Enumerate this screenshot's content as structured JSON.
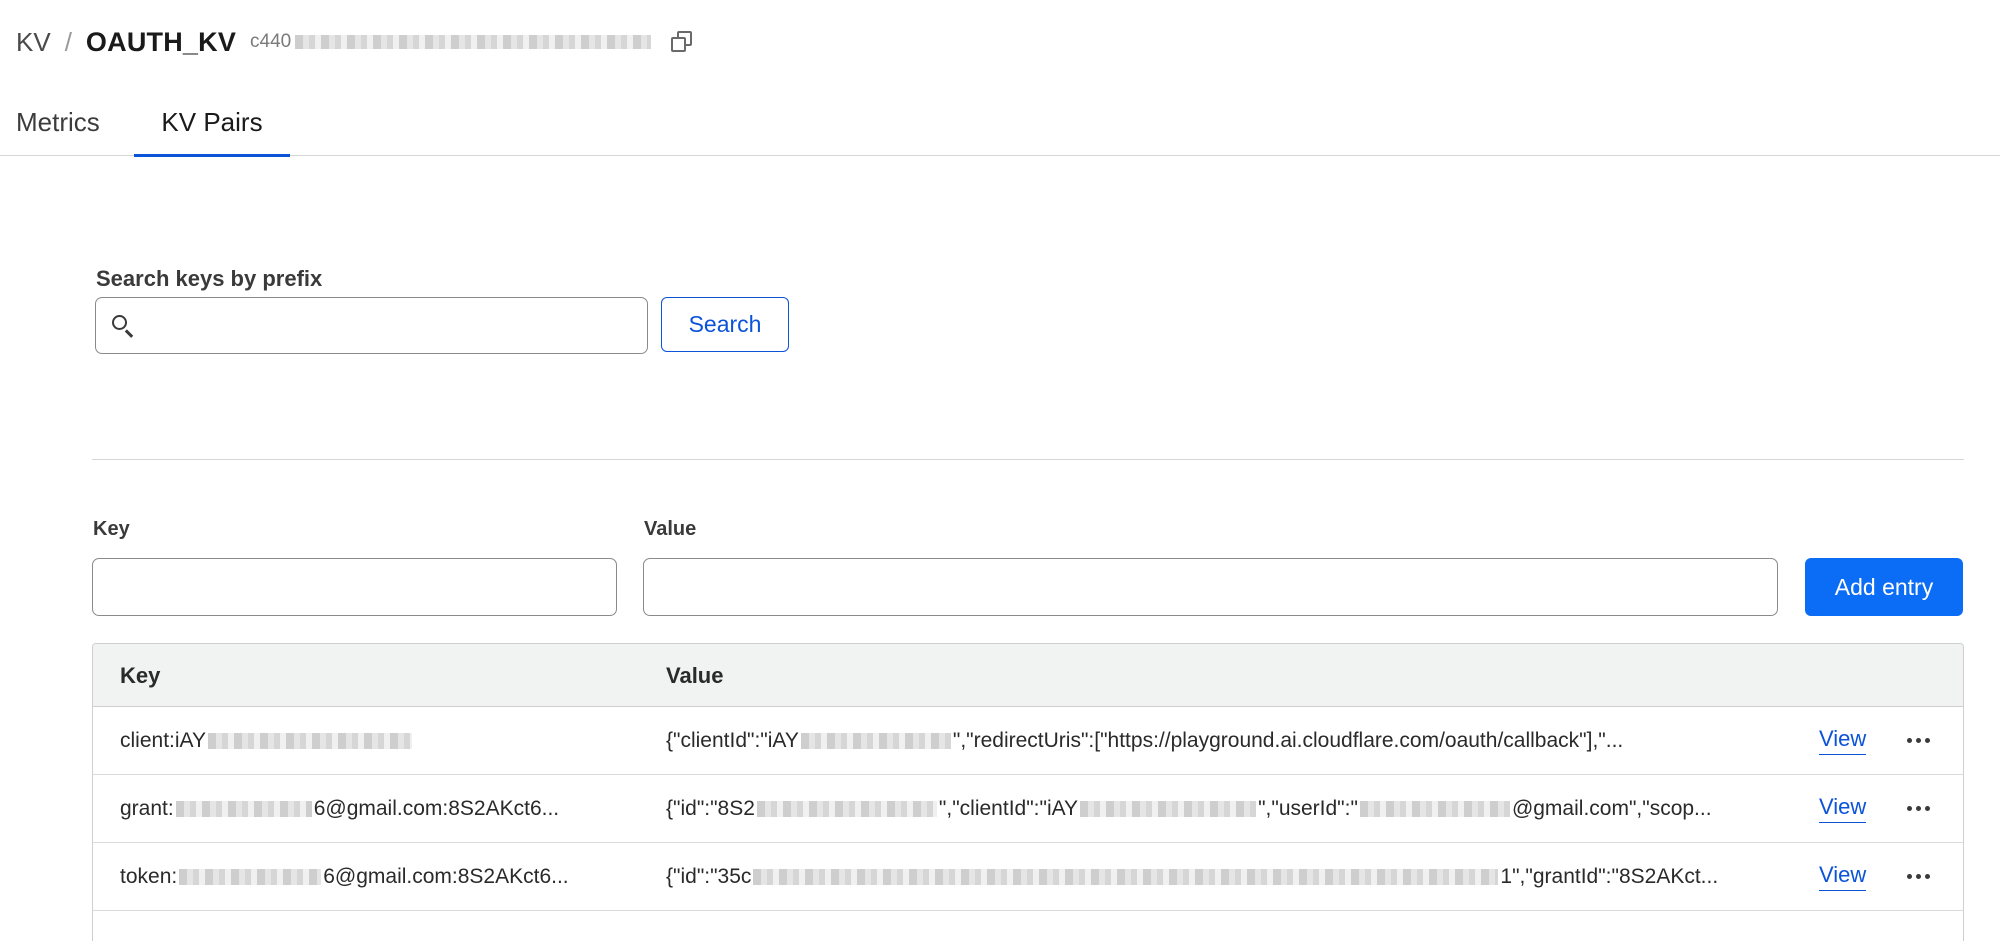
{
  "breadcrumb": {
    "root": "KV",
    "separator": "/",
    "current": "OAUTH_KV",
    "namespace_id_prefix": "c440"
  },
  "tabs": [
    {
      "label": "Metrics",
      "active": false
    },
    {
      "label": "KV Pairs",
      "active": true
    }
  ],
  "search": {
    "label": "Search keys by prefix",
    "value": "",
    "button_label": "Search"
  },
  "add_entry": {
    "key_label": "Key",
    "value_label": "Value",
    "key_value": "",
    "value_value": "",
    "button_label": "Add entry"
  },
  "table": {
    "columns": [
      "Key",
      "Value"
    ],
    "rows": [
      {
        "key_start": "client:iAY",
        "key_end": "",
        "value_start": "{\"clientId\":\"iAY",
        "value_end": "\",\"redirectUris\":[\"https://playground.ai.cloudflare.com/oauth/callback\"],\"...",
        "action_label": "View"
      },
      {
        "key_start": "grant:",
        "key_end": "6@gmail.com:8S2AKct6...",
        "value_start": "{\"id\":\"8S2",
        "value_end": "\",\"clientId\":\"iAY",
        "value_tail_a": "\",\"userId\":\"",
        "value_tail_b": "@gmail.com\",\"scop...",
        "action_label": "View"
      },
      {
        "key_start": "token:",
        "key_end": "6@gmail.com:8S2AKct6...",
        "value_start": "{\"id\":\"35c",
        "value_end": "1\",\"grantId\":\"8S2AKct...",
        "action_label": "View"
      }
    ]
  },
  "icons": {
    "copy": "copy-icon",
    "search": "search-icon",
    "more": "more-horizontal-icon"
  },
  "colors": {
    "accent": "#0b53d9",
    "primary_button": "#0b6cf5"
  }
}
